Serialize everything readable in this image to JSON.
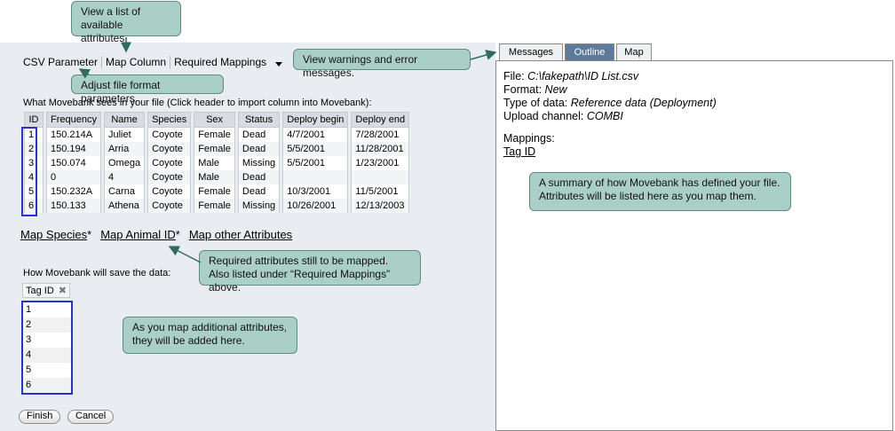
{
  "toolbar": {
    "items": [
      "CSV Parameter",
      "Map Column",
      "Required Mappings"
    ]
  },
  "file_label": "What Movebank sees in your file (Click header to import column into Movebank):",
  "table": {
    "headers": [
      "ID",
      "Frequency",
      "Name",
      "Species",
      "Sex",
      "Status",
      "Deploy begin",
      "Deploy end"
    ],
    "rows": [
      [
        "1",
        "150.214A",
        "Juliet",
        "Coyote",
        "Female",
        "Dead",
        "4/7/2001",
        "7/28/2001"
      ],
      [
        "2",
        "150.194",
        "Arria",
        "Coyote",
        "Female",
        "Dead",
        "5/5/2001",
        "11/28/2001"
      ],
      [
        "3",
        "150.074",
        "Omega",
        "Coyote",
        "Male",
        "Missing",
        "5/5/2001",
        "1/23/2001"
      ],
      [
        "4",
        "0",
        "4",
        "Coyote",
        "Male",
        "Dead",
        "",
        ""
      ],
      [
        "5",
        "150.232A",
        "Carna",
        "Coyote",
        "Female",
        "Dead",
        "10/3/2001",
        "11/5/2001"
      ],
      [
        "6",
        "150.133",
        "Athena",
        "Coyote",
        "Female",
        "Missing",
        "10/26/2001",
        "12/13/2003"
      ]
    ]
  },
  "links": {
    "map_species": "Map Species",
    "map_animal_id": "Map Animal ID",
    "map_other": "Map other Attributes",
    "required_marker": "*"
  },
  "save_label": "How Movebank will save the data:",
  "tag_chip": {
    "label": "Tag ID",
    "icon": "close-icon"
  },
  "save_values": [
    "1",
    "2",
    "3",
    "4",
    "5",
    "6"
  ],
  "buttons": {
    "finish": "Finish",
    "cancel": "Cancel"
  },
  "tabs": {
    "messages": "Messages",
    "outline": "Outline",
    "map": "Map",
    "active": "Outline"
  },
  "outline": {
    "file_label": "File:",
    "file_value": "C:\\fakepath\\ID List.csv",
    "format_label": "Format:",
    "format_value": "New",
    "type_label": "Type of data:",
    "type_value": "Reference data (Deployment)",
    "channel_label": "Upload channel:",
    "channel_value": "COMBI",
    "mappings_label": "Mappings:",
    "mapping_item": "Tag ID"
  },
  "callouts": {
    "attributes": "View a list of available attributes.",
    "format": "Adjust file format parameters.",
    "warnings": "View warnings and error messages.",
    "summary": "A summary of how Movebank has defined your file. Attributes will be listed here as you map them.",
    "required": "Required attributes still to be mapped. Also listed under “Required Mappings” above.",
    "additional": "As you map additional attributes, they will be added here."
  },
  "colors": {
    "callout_bg": "#a9cfc6",
    "callout_border": "#5e8c80",
    "highlight_border": "#2632d1",
    "active_tab": "#5e7a9a"
  }
}
